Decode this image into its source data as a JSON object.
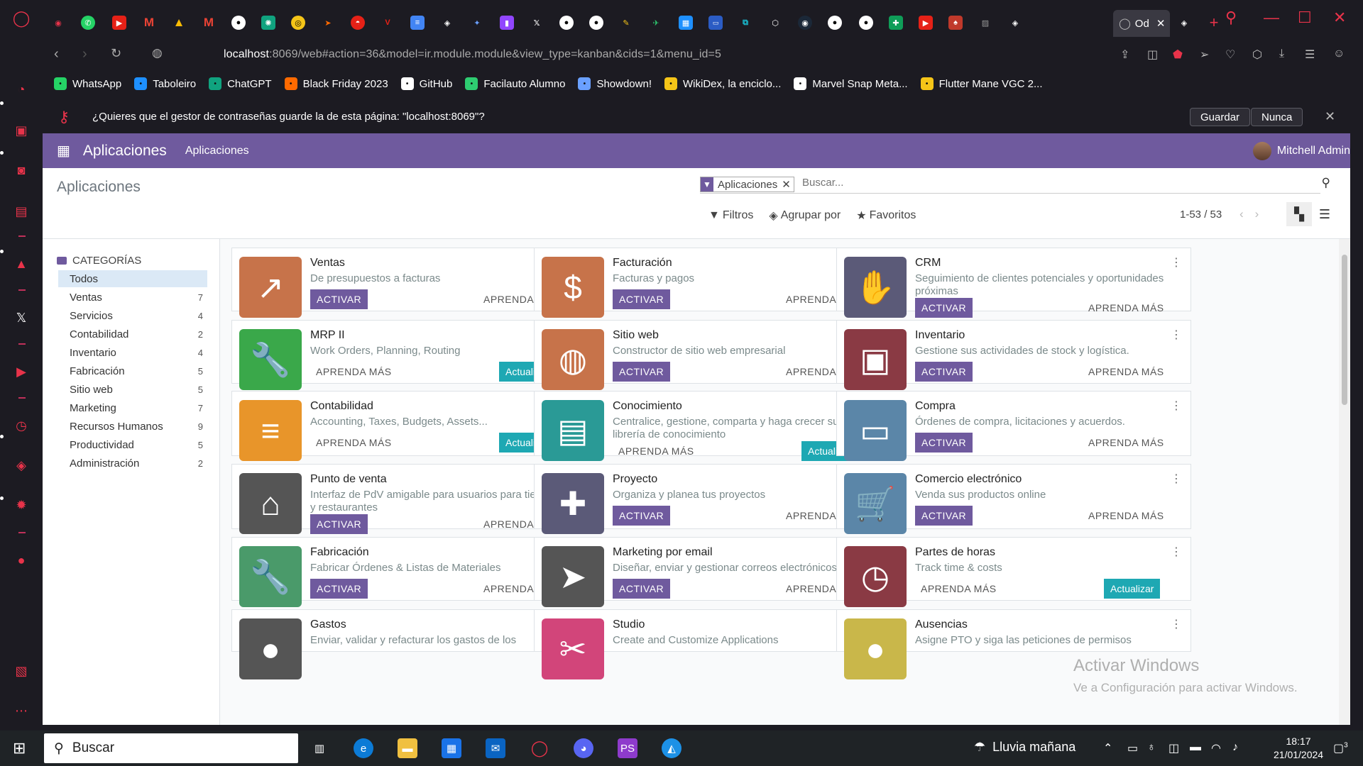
{
  "browser": {
    "active_tab_label": "Od",
    "url_host": "localhost",
    "url_rest": ":8069/web#action=36&model=ir.module.module&view_type=kanban&cids=1&menu_id=5",
    "bookmarks": [
      {
        "label": "WhatsApp",
        "color": "#25d366",
        "icon": "whatsapp-icon"
      },
      {
        "label": "Taboleiro",
        "color": "#1e90ff",
        "icon": "taboleiro-icon"
      },
      {
        "label": "ChatGPT",
        "color": "#10a37f",
        "icon": "chatgpt-icon"
      },
      {
        "label": "Black Friday 2023",
        "color": "#ff6a00",
        "icon": "blackfriday-icon"
      },
      {
        "label": "GitHub",
        "color": "#ffffff",
        "icon": "github-icon"
      },
      {
        "label": "Facilauto Alumno",
        "color": "#2ecc71",
        "icon": "facilauto-icon"
      },
      {
        "label": "Showdown!",
        "color": "#6aa0ff",
        "icon": "showdown-icon"
      },
      {
        "label": "WikiDex, la enciclo...",
        "color": "#f5c518",
        "icon": "wikidex-icon"
      },
      {
        "label": "Marvel Snap Meta...",
        "color": "#ffffff",
        "icon": "page-icon"
      },
      {
        "label": "Flutter Mane VGC 2...",
        "color": "#f5c518",
        "icon": "flutter-icon"
      }
    ],
    "password_prompt": "¿Quieres que el gestor de contraseñas guarde la de esta página: \"localhost:8069\"?",
    "save_label": "Guardar",
    "never_label": "Nunca"
  },
  "odoo": {
    "app_name": "Aplicaciones",
    "nav_link": "Aplicaciones",
    "user_name": "Mitchell Admin",
    "breadcrumb": "Aplicaciones",
    "facet_label": "Aplicaciones",
    "search_placeholder": "Buscar...",
    "filters_label": "Filtros",
    "groupby_label": "Agrupar por",
    "favorites_label": "Favoritos",
    "pager": "1-53 / 53",
    "categories_title": "CATEGORÍAS",
    "categories": [
      {
        "label": "Todos",
        "count": ""
      },
      {
        "label": "Ventas",
        "count": "7"
      },
      {
        "label": "Servicios",
        "count": "4"
      },
      {
        "label": "Contabilidad",
        "count": "2"
      },
      {
        "label": "Inventario",
        "count": "4"
      },
      {
        "label": "Fabricación",
        "count": "5"
      },
      {
        "label": "Sitio web",
        "count": "5"
      },
      {
        "label": "Marketing",
        "count": "7"
      },
      {
        "label": "Recursos Humanos",
        "count": "9"
      },
      {
        "label": "Productividad",
        "count": "5"
      },
      {
        "label": "Administración",
        "count": "2"
      }
    ],
    "activate_label": "ACTIVAR",
    "learn_label": "APRENDA MÁS",
    "update_label": "Actualizar",
    "apps": [
      {
        "title": "Ventas",
        "sub": "De presupuestos a facturas",
        "state": "activate",
        "color": "#c7734a",
        "icon": "chart-up-icon"
      },
      {
        "title": "Facturación",
        "sub": "Facturas y pagos",
        "state": "activate",
        "color": "#c7734a",
        "icon": "invoice-icon"
      },
      {
        "title": "CRM",
        "sub": "Seguimiento de clientes potenciales y oportunidades próximas",
        "state": "activate",
        "color": "#5b5a78",
        "icon": "handshake-icon"
      },
      {
        "title": "MRP II",
        "sub": "Work Orders, Planning, Routing",
        "state": "update",
        "color": "#3aa84a",
        "icon": "wrench-icon"
      },
      {
        "title": "Sitio web",
        "sub": "Constructor de sitio web empresarial",
        "state": "activate",
        "color": "#c7734a",
        "icon": "globe-icon"
      },
      {
        "title": "Inventario",
        "sub": "Gestione sus actividades de stock y logística.",
        "state": "activate",
        "color": "#8a3a44",
        "icon": "box-icon"
      },
      {
        "title": "Contabilidad",
        "sub": "Accounting, Taxes, Budgets, Assets...",
        "state": "update",
        "color": "#e8952a",
        "icon": "document-icon"
      },
      {
        "title": "Conocimiento",
        "sub": "Centralice, gestione, comparta y haga crecer su librería de conocimiento",
        "state": "update",
        "color": "#2a9a96",
        "icon": "book-icon"
      },
      {
        "title": "Compra",
        "sub": "Órdenes de compra, licitaciones y acuerdos.",
        "state": "activate",
        "color": "#5b86a8",
        "icon": "credit-card-icon"
      },
      {
        "title": "Punto de venta",
        "sub": "Interfaz de PdV amigable para usuarios para tiendas y restaurantes",
        "state": "activate",
        "color": "#555555",
        "icon": "shop-icon"
      },
      {
        "title": "Proyecto",
        "sub": "Organiza y planea tus proyectos",
        "state": "activate",
        "color": "#5b5a78",
        "icon": "puzzle-icon"
      },
      {
        "title": "Comercio electrónico",
        "sub": "Venda sus productos online",
        "state": "activate",
        "color": "#5b86a8",
        "icon": "cart-icon"
      },
      {
        "title": "Fabricación",
        "sub": "Fabricar Órdenes & Listas de Materiales",
        "state": "activate",
        "color": "#4a9a6a",
        "icon": "wrench-icon"
      },
      {
        "title": "Marketing por email",
        "sub": "Diseñar, enviar y gestionar correos electrónicos",
        "state": "activate",
        "color": "#555555",
        "icon": "paper-plane-icon"
      },
      {
        "title": "Partes de horas",
        "sub": "Track time & costs",
        "state": "update",
        "color": "#8a3a44",
        "icon": "stopwatch-icon"
      },
      {
        "title": "Gastos",
        "sub": "Enviar, validar y refacturar los gastos de los",
        "state": "activate",
        "color": "#555555",
        "icon": "user-icon"
      },
      {
        "title": "Studio",
        "sub": "Create and Customize Applications",
        "state": "activate",
        "color": "#d2457a",
        "icon": "tools-icon"
      },
      {
        "title": "Ausencias",
        "sub": "Asigne PTO y siga las peticiones de permisos",
        "state": "activate",
        "color": "#c9b74a",
        "icon": "user-icon"
      }
    ]
  },
  "watermark": {
    "line1": "Activar Windows",
    "line2": "Ve a Configuración para activar Windows."
  },
  "taskbar": {
    "search_label": "Buscar",
    "weather": "Lluvia mañana",
    "time": "18:17",
    "date": "21/01/2024",
    "notifications": "3"
  }
}
